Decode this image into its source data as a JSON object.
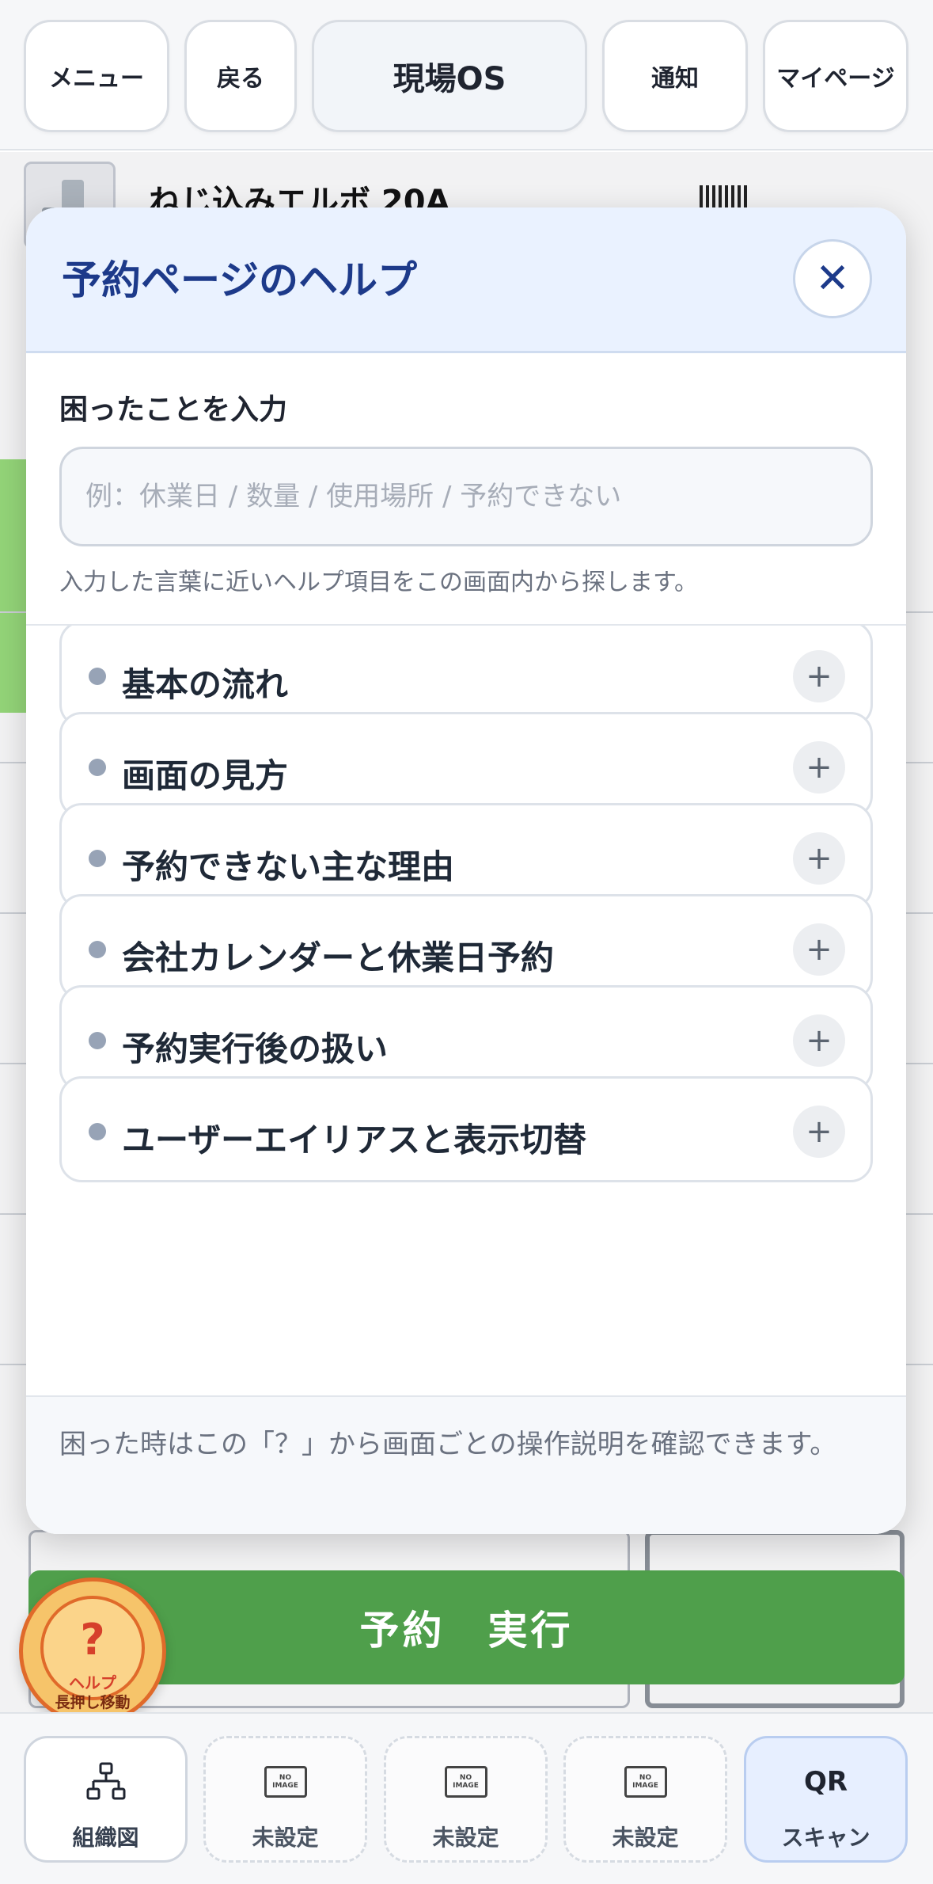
{
  "nav": {
    "menu": "メニュー",
    "back": "戻る",
    "title": "現場OS",
    "notifications": "通知",
    "mypage": "マイページ"
  },
  "background": {
    "product_name": "ねじ込みエルボ 20A",
    "reserve_button": "予約　実行"
  },
  "help_modal": {
    "title": "予約ページのヘルプ",
    "close_icon": "close-icon",
    "search_label": "困ったことを入力",
    "search_placeholder": "例：休業日 / 数量 / 使用場所 / 予約できない",
    "search_value": "",
    "search_hint": "入力した言葉に近いヘルプ項目をこの画面内から探します。",
    "items": [
      {
        "label": "基本の流れ"
      },
      {
        "label": "画面の見方"
      },
      {
        "label": "予約できない主な理由"
      },
      {
        "label": "会社カレンダーと休業日予約"
      },
      {
        "label": "予約実行後の扱い"
      },
      {
        "label": "ユーザーエイリアスと表示切替"
      }
    ],
    "footer": "困った時はこの「？」から画面ごとの操作説明を確認できます。"
  },
  "help_fab": {
    "symbol": "?",
    "label": "ヘルプ",
    "sublabel": "長押し移動"
  },
  "bottom_tabs": {
    "org_chart": "組織図",
    "slot1": "未設定",
    "slot2": "未設定",
    "slot3": "未設定",
    "qr_title": "QR",
    "qr_label": "スキャン"
  },
  "colors": {
    "accent_blue": "#1d3a8a",
    "reserve_green": "#4f9f4b",
    "help_orange": "#e06a2a"
  }
}
